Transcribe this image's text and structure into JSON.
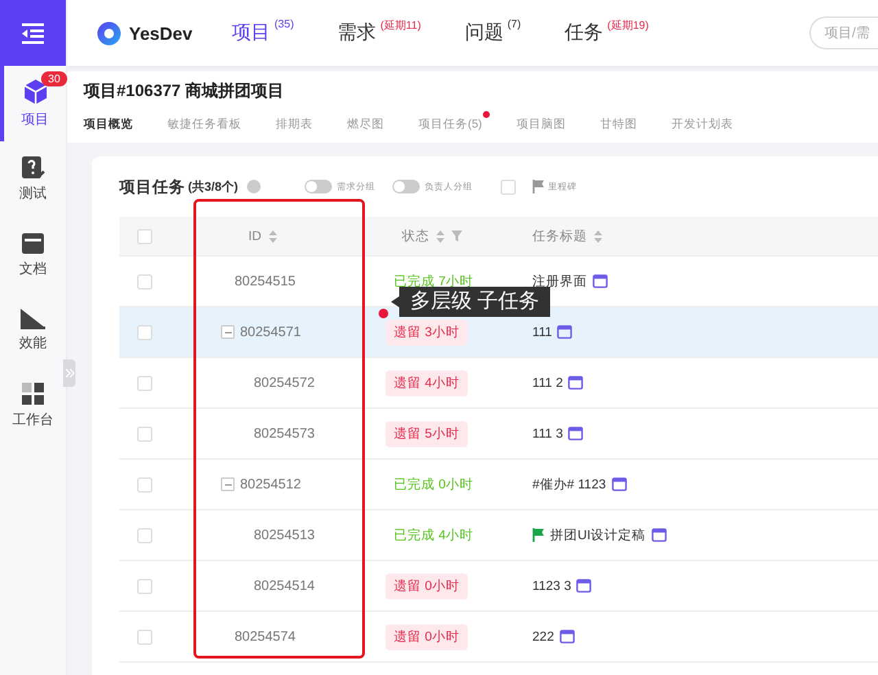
{
  "sidebar": {
    "items": [
      {
        "label": "项目",
        "selected": true,
        "badge": "30"
      },
      {
        "label": "测试",
        "selected": false
      },
      {
        "label": "文档",
        "selected": false
      },
      {
        "label": "效能",
        "selected": false
      },
      {
        "label": "工作台",
        "selected": false
      }
    ]
  },
  "header": {
    "logo": "YesDev",
    "nav": [
      {
        "label": "项目",
        "count": "(35)",
        "alert": false,
        "selected": true
      },
      {
        "label": "需求",
        "count": "(延期11)",
        "alert": true,
        "selected": false
      },
      {
        "label": "问题",
        "count": "(7)",
        "alert": false,
        "selected": false
      },
      {
        "label": "任务",
        "count": "(延期19)",
        "alert": true,
        "selected": false
      }
    ],
    "search": {
      "placeholder": "项目/需"
    }
  },
  "project": {
    "title": "项目#106377 商城拼团项目",
    "tabs": [
      {
        "label": "项目概览",
        "selected": true,
        "dot": false
      },
      {
        "label": "敏捷任务看板",
        "selected": false,
        "dot": false
      },
      {
        "label": "排期表",
        "selected": false,
        "dot": false
      },
      {
        "label": "燃尽图",
        "selected": false,
        "dot": false
      },
      {
        "label": "项目任务(5)",
        "selected": false,
        "dot": true
      },
      {
        "label": "项目脑图",
        "selected": false,
        "dot": false
      },
      {
        "label": "甘特图",
        "selected": false,
        "dot": false
      },
      {
        "label": "开发计划表",
        "selected": false,
        "dot": false
      }
    ]
  },
  "tasks": {
    "title": "项目任务",
    "count": "(共3/8个)",
    "toggles": [
      {
        "label": "需求分组",
        "on": false
      },
      {
        "label": "负责人分组",
        "on": false
      }
    ],
    "milestone": {
      "label": "里程碑",
      "checked": false
    },
    "all_checked": false,
    "columns": [
      "ID",
      "状态",
      "任务标题"
    ],
    "rows": [
      {
        "id": "80254515",
        "status": "已完成 7小时",
        "kind": "done",
        "title": "注册界面",
        "milestone": false,
        "selected": false,
        "checked": false
      },
      {
        "id": "80254571",
        "status": "遗留 3小时",
        "kind": "overdue",
        "title": "111",
        "milestone": false,
        "selected": true,
        "checked": false,
        "expanded": true,
        "children": [
          {
            "id": "80254572",
            "status": "遗留 4小时",
            "kind": "overdue",
            "title": "111 2",
            "milestone": false,
            "selected": false,
            "checked": false
          },
          {
            "id": "80254573",
            "status": "遗留 5小时",
            "kind": "overdue",
            "title": "111 3",
            "milestone": false,
            "selected": false,
            "checked": false
          }
        ]
      },
      {
        "id": "80254512",
        "status": "已完成 0小时",
        "kind": "done",
        "title": "#催办# 1123",
        "milestone": false,
        "selected": false,
        "checked": false,
        "expanded": true,
        "children": [
          {
            "id": "80254513",
            "status": "已完成 4小时",
            "kind": "done",
            "title": "拼团UI设计定稿",
            "milestone": true,
            "selected": false,
            "checked": false
          },
          {
            "id": "80254514",
            "status": "遗留 0小时",
            "kind": "overdue",
            "title": "1123 3",
            "milestone": false,
            "selected": false,
            "checked": false
          }
        ]
      },
      {
        "id": "80254574",
        "status": "遗留 0小时",
        "kind": "overdue",
        "title": "222",
        "milestone": false,
        "selected": false,
        "checked": false
      }
    ]
  },
  "tooltip": {
    "text": "多层级 子任务"
  }
}
